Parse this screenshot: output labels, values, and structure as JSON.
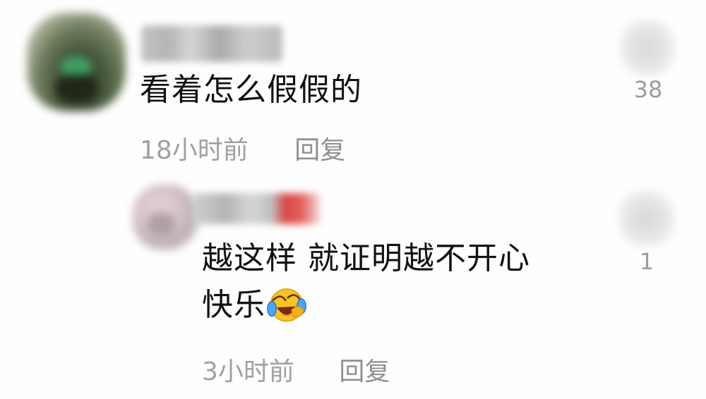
{
  "comments": [
    {
      "text": "看着怎么假假的",
      "time": "18小时前",
      "reply_label": "回复",
      "like_count": "38",
      "avatar_icon": "blurred-user-avatar",
      "like_icon": "blurred-like-icon"
    },
    {
      "text_line1": "越这样 就证明越不开心",
      "text_line2": "快乐",
      "emoji": "laughing-crying-face",
      "time": "3小时前",
      "reply_label": "回复",
      "like_count": "1",
      "avatar_icon": "blurred-user-avatar",
      "like_icon": "blurred-like-icon"
    }
  ],
  "colors": {
    "text_primary": "#111111",
    "text_secondary": "#a0a0a0",
    "username_red_accent": "#d32626"
  }
}
